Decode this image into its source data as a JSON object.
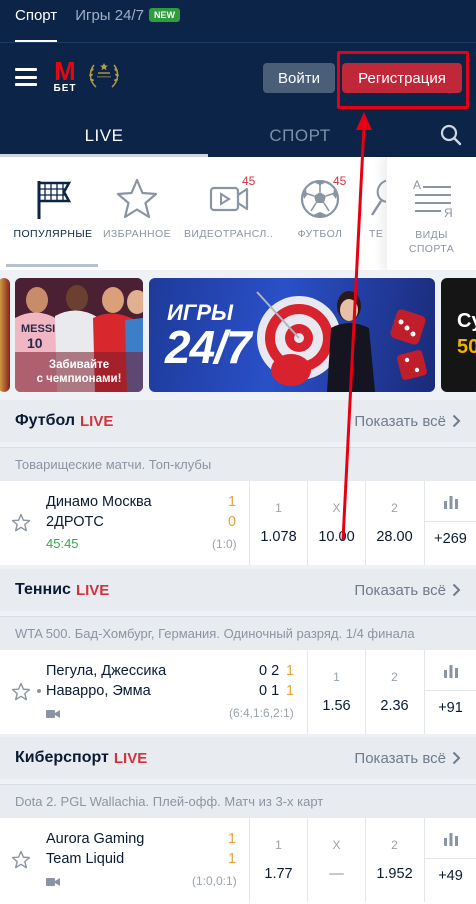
{
  "topnav": {
    "tab_sport": "Спорт",
    "tab_games": "Игры 24/7",
    "new_badge": "NEW"
  },
  "header": {
    "logo_letter": "M",
    "logo_text": "БЕТ",
    "login_label": "Войти",
    "register_label": "Регистрация"
  },
  "sportbar": {
    "live_label": "LIVE",
    "sport_label": "СПОРТ"
  },
  "categories": [
    {
      "label": "ПОПУЛЯРНЫЕ",
      "icon": "flag-grid-icon"
    },
    {
      "label": "ИЗБРАННОЕ",
      "icon": "star-icon"
    },
    {
      "label": "ВИДЕОТРАНСЛ...",
      "icon": "video-camera-icon",
      "count": "45"
    },
    {
      "label": "ФУТБОЛ",
      "icon": "soccer-ball-icon",
      "count": "45"
    },
    {
      "label": "ТЕ",
      "icon": "tennis-icon"
    }
  ],
  "categories_more": {
    "label_line1": "ВИДЫ",
    "label_line2": "СПОРТА",
    "icon_top": "А",
    "icon_bottom": "Я"
  },
  "banners": [
    {
      "name": "champions-banner",
      "text_line1": "Забивайте",
      "text_line2": "с чемпионами!",
      "player1": "MESSI",
      "player2": "10"
    },
    {
      "name": "games-247-banner",
      "text_line1": "ИГРЫ",
      "text_line2": "24/7"
    },
    {
      "name": "super-banner",
      "text_line1": "Су",
      "text_line2": "50"
    }
  ],
  "sections": [
    {
      "title": "Футбол",
      "live": "LIVE",
      "show_all": "Показать всё",
      "subtitle": "Товарищеские матчи. Топ-клубы",
      "match": {
        "team1": "Динамо Москва",
        "team2": "2ДРОТС",
        "score1": "1",
        "score2": "0",
        "time": "45:45",
        "result": "(1:0)",
        "odds": [
          {
            "k": "1",
            "v": "1.078"
          },
          {
            "k": "X",
            "v": "10.00"
          },
          {
            "k": "2",
            "v": "28.00"
          }
        ],
        "more": "+269"
      }
    },
    {
      "title": "Теннис",
      "live": "LIVE",
      "show_all": "Показать всё",
      "subtitle": "WTA 500. Бад-Хомбург, Германия. Одиночный разряд. 1/4 финала",
      "match": {
        "team1": "Пегула, Джессика",
        "team2": "Наварро, Эмма",
        "sets1": "0 2",
        "game1": "1",
        "sets2": "0 1",
        "game2": "1",
        "result": "(6:4,1:6,2:1)",
        "odds": [
          {
            "k": "1",
            "v": "1.56"
          },
          {
            "k": "2",
            "v": "2.36"
          }
        ],
        "more": "+91"
      }
    },
    {
      "title": "Киберспорт",
      "live": "LIVE",
      "show_all": "Показать всё",
      "subtitle": "Dota 2. PGL Wallachia. Плей-офф. Матч из 3-х карт",
      "match": {
        "team1": "Aurora Gaming",
        "team2": "Team Liquid",
        "score1": "1",
        "score2": "1",
        "result": "(1:0,0:1)",
        "odds": [
          {
            "k": "1",
            "v": "1.77"
          },
          {
            "k": "X",
            "v": "—"
          },
          {
            "k": "2",
            "v": "1.952"
          }
        ],
        "more": "+49"
      }
    }
  ],
  "colors": {
    "navy": "#0b2447",
    "red": "#c0283a",
    "accent_orange": "#e8a33b",
    "live_red": "#d2343e",
    "time_green": "#3aa64e"
  }
}
